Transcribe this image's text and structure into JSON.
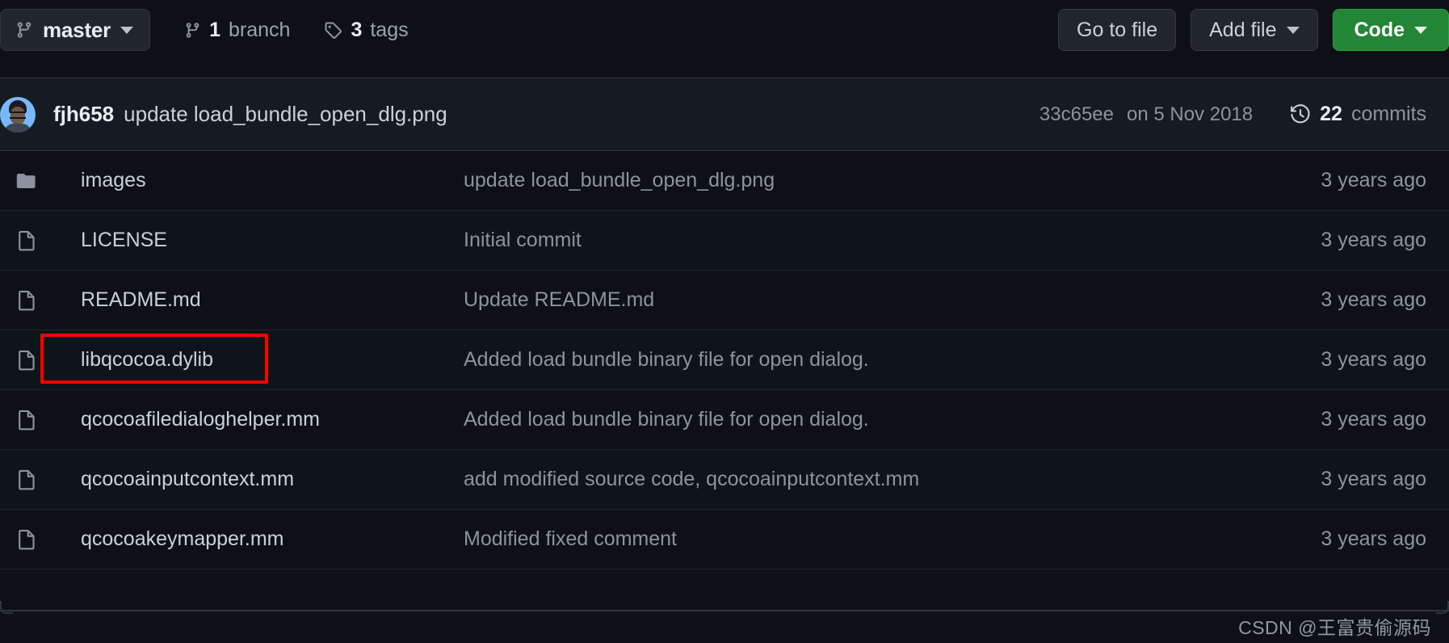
{
  "toolbar": {
    "branch": {
      "icon": "branch-icon",
      "label": "master",
      "caret": "chevron-down-icon"
    },
    "branch_count": {
      "num": "1",
      "word": "branch",
      "icon": "branch-icon"
    },
    "tag_count": {
      "num": "3",
      "word": "tags",
      "icon": "tag-icon"
    },
    "go_to_file": "Go to file",
    "add_file": "Add file",
    "code": "Code"
  },
  "commit_header": {
    "avatar": "user-avatar",
    "author": "fjh658",
    "message": "update load_bundle_open_dlg.png",
    "sha": "33c65ee",
    "date": "on 5 Nov 2018",
    "commits_num": "22",
    "commits_word": "commits",
    "history_icon": "history-clock-icon"
  },
  "files": [
    {
      "icon": "folder-icon",
      "name": "images",
      "message": "update load_bundle_open_dlg.png",
      "age": "3 years ago",
      "highlighted": false
    },
    {
      "icon": "file-icon",
      "name": "LICENSE",
      "message": "Initial commit",
      "age": "3 years ago",
      "highlighted": false
    },
    {
      "icon": "file-icon",
      "name": "README.md",
      "message": "Update README.md",
      "age": "3 years ago",
      "highlighted": false
    },
    {
      "icon": "file-icon",
      "name": "libqcocoa.dylib",
      "message": "Added load bundle binary file for open dialog.",
      "age": "3 years ago",
      "highlighted": true
    },
    {
      "icon": "file-icon",
      "name": "qcocoafiledialoghelper.mm",
      "message": "Added load bundle binary file for open dialog.",
      "age": "3 years ago",
      "highlighted": false
    },
    {
      "icon": "file-icon",
      "name": "qcocoainputcontext.mm",
      "message": "add modified source code, qcocoainputcontext.mm",
      "age": "3 years ago",
      "highlighted": false
    },
    {
      "icon": "file-icon",
      "name": "qcocoakeymapper.mm",
      "message": "Modified fixed comment",
      "age": "3 years ago",
      "highlighted": false
    }
  ],
  "watermark": "CSDN @王富贵偷源码",
  "colors": {
    "page_bg": "#0d1117",
    "header_bg": "#161b22",
    "border": "#30363d",
    "text_primary": "#c9d1d9",
    "text_muted": "#8b949e",
    "code_green": "#238636",
    "annotation_red": "#ff0000"
  }
}
